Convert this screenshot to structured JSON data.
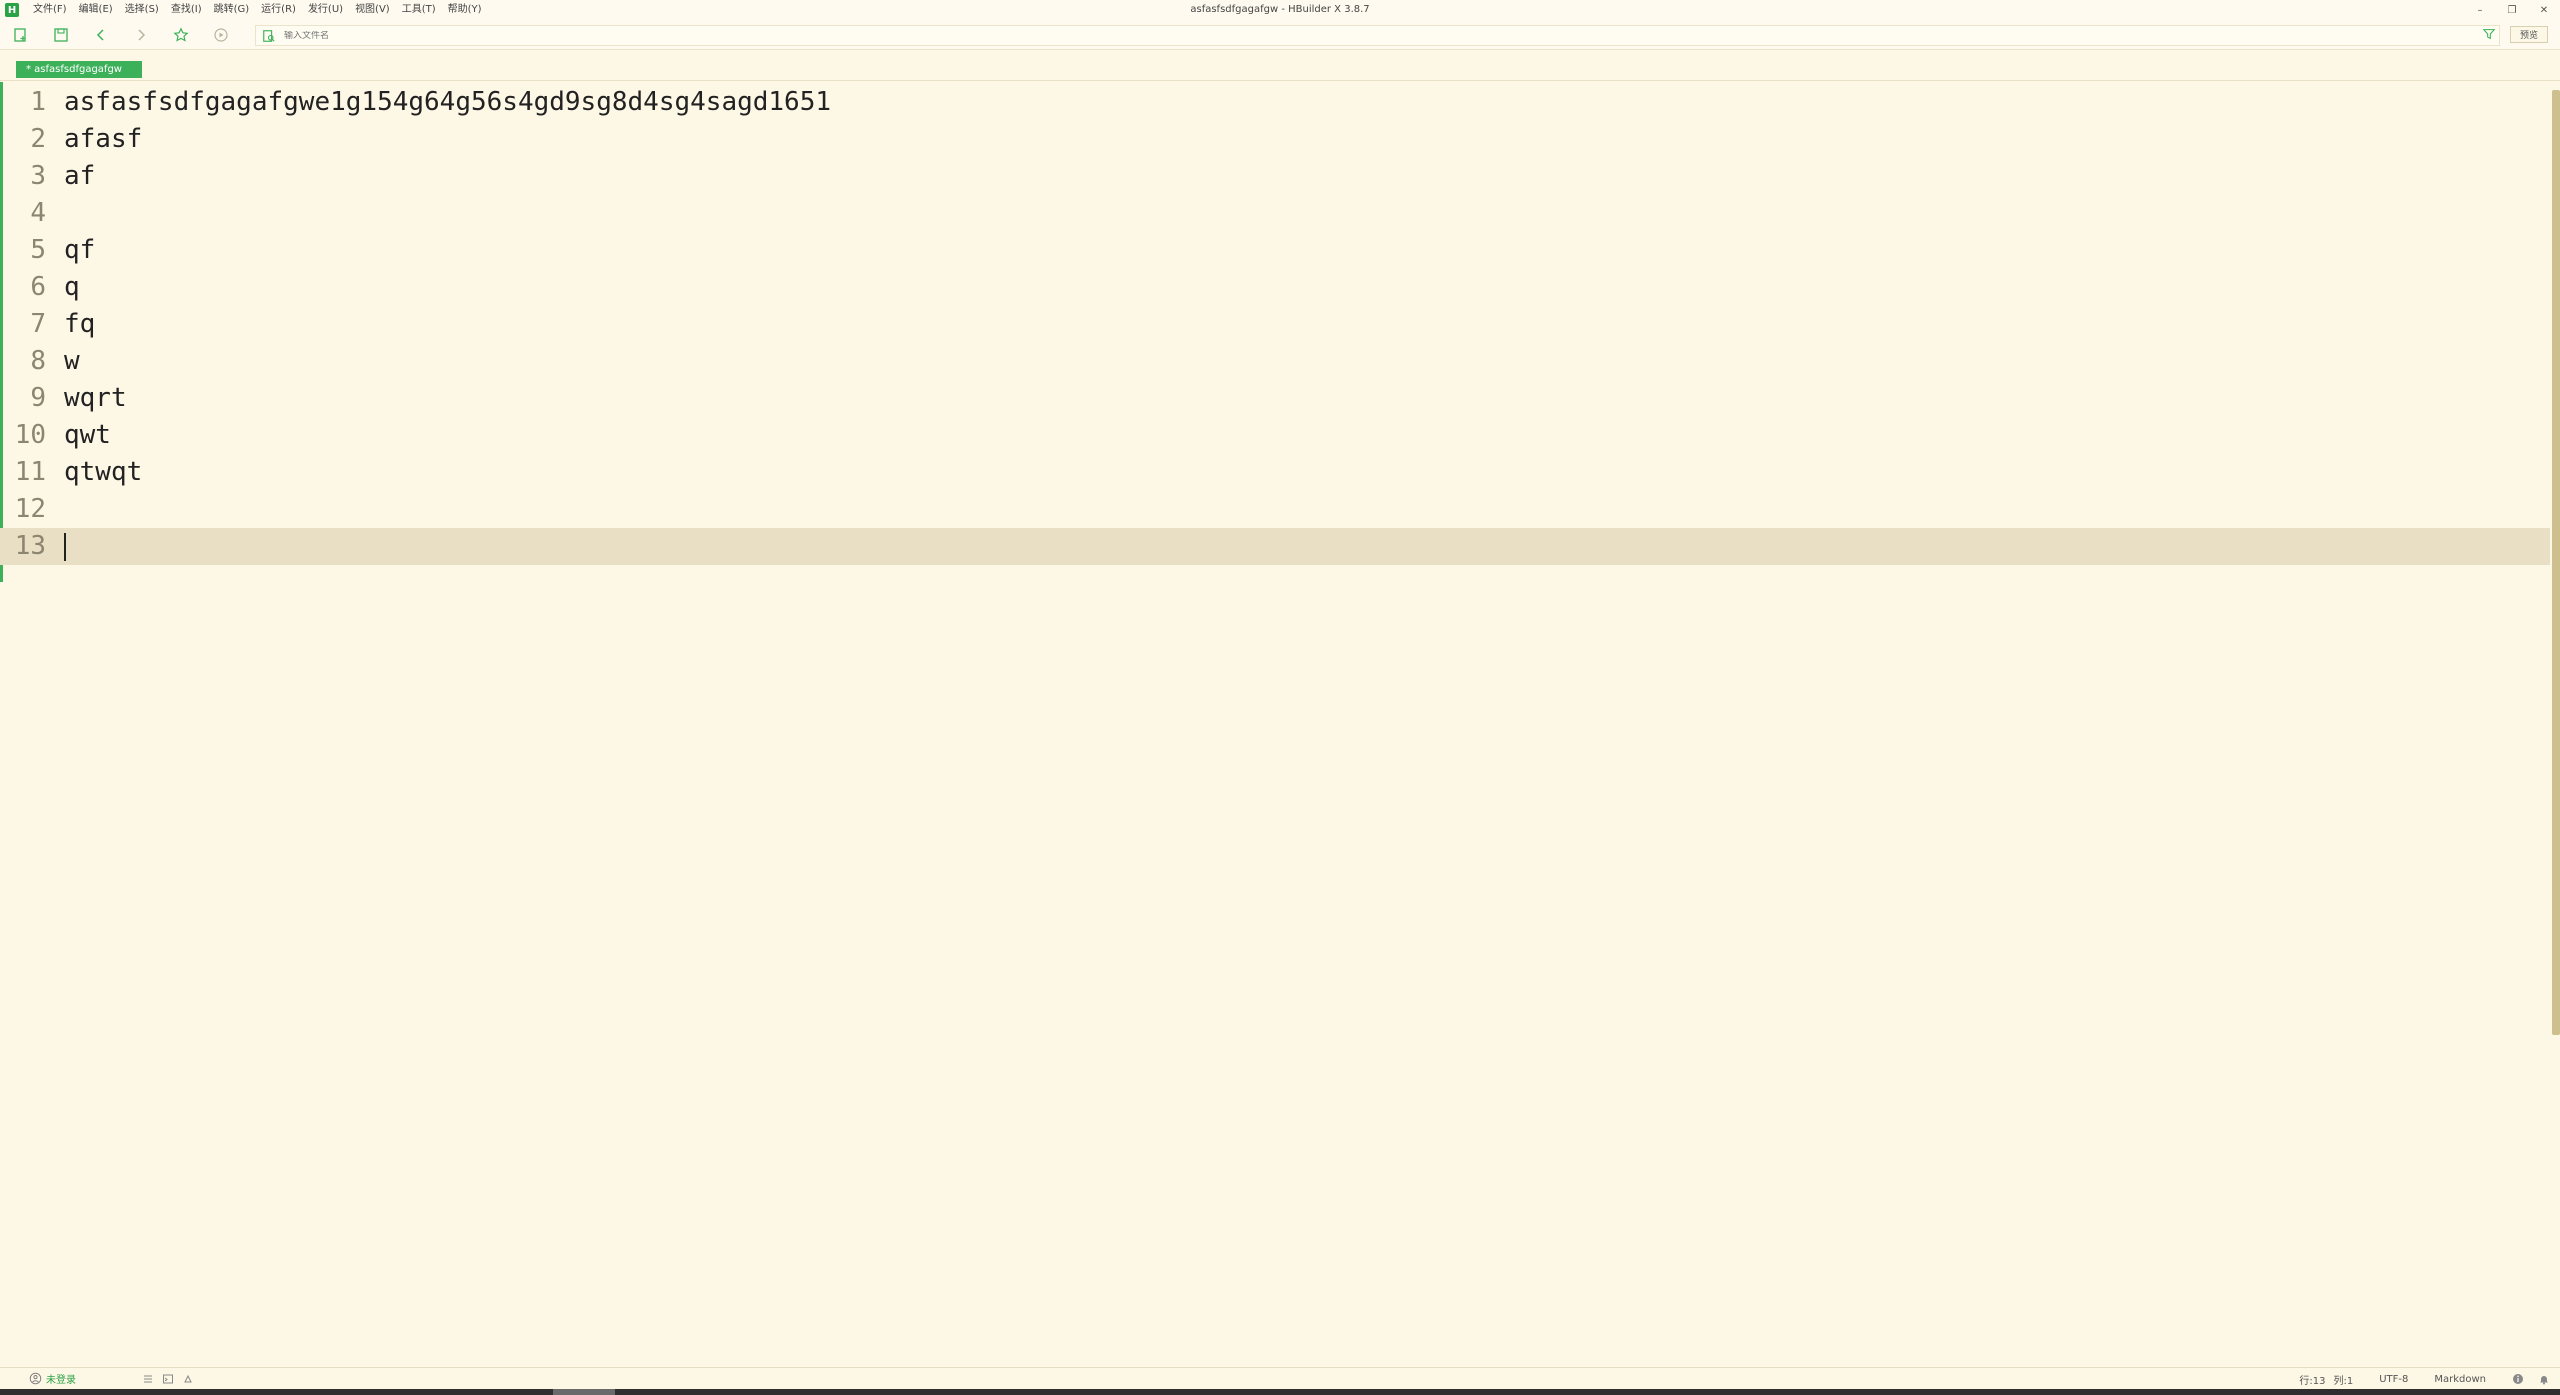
{
  "app": {
    "logo": "H",
    "window_title": "asfasfsdfgagafgw - HBuilder X 3.8.7"
  },
  "menu": [
    {
      "label": "文件(F)"
    },
    {
      "label": "编辑(E)"
    },
    {
      "label": "选择(S)"
    },
    {
      "label": "查找(I)"
    },
    {
      "label": "跳转(G)"
    },
    {
      "label": "运行(R)"
    },
    {
      "label": "发行(U)"
    },
    {
      "label": "视图(V)"
    },
    {
      "label": "工具(T)"
    },
    {
      "label": "帮助(Y)"
    }
  ],
  "window_controls": {
    "minimize": "–",
    "restore": "❐",
    "close": "✕"
  },
  "toolbar": {
    "address_placeholder": "输入文件名",
    "preview_label": "预览",
    "icons": [
      "new-file-icon",
      "save-icon",
      "back-icon",
      "forward-icon",
      "star-icon",
      "run-icon",
      "open-file-icon",
      "filter-icon"
    ]
  },
  "tabs": [
    {
      "label": "* asfasfsdfgagafgw",
      "active": true
    }
  ],
  "editor": {
    "lines": [
      {
        "num": "1",
        "text": "asfasfsdfgagafgwe1g154g64g56s4gd9sg8d4sg4sagd1651"
      },
      {
        "num": "2",
        "text": "afasf"
      },
      {
        "num": "3",
        "text": "af"
      },
      {
        "num": "4",
        "text": ""
      },
      {
        "num": "5",
        "text": "qf"
      },
      {
        "num": "6",
        "text": "q"
      },
      {
        "num": "7",
        "text": "fq"
      },
      {
        "num": "8",
        "text": "w"
      },
      {
        "num": "9",
        "text": "wqrt"
      },
      {
        "num": "10",
        "text": "qwt"
      },
      {
        "num": "11",
        "text": "qtwqt"
      },
      {
        "num": "12",
        "text": ""
      },
      {
        "num": "13",
        "text": ""
      }
    ],
    "current_line": 13
  },
  "statusbar": {
    "login": "未登录",
    "row": "行:13",
    "col": "列:1",
    "encoding": "UTF-8",
    "language": "Markdown"
  },
  "colors": {
    "accent": "#3cb15a",
    "background": "#fdf7e6",
    "current_line": "#e9dfc4"
  }
}
